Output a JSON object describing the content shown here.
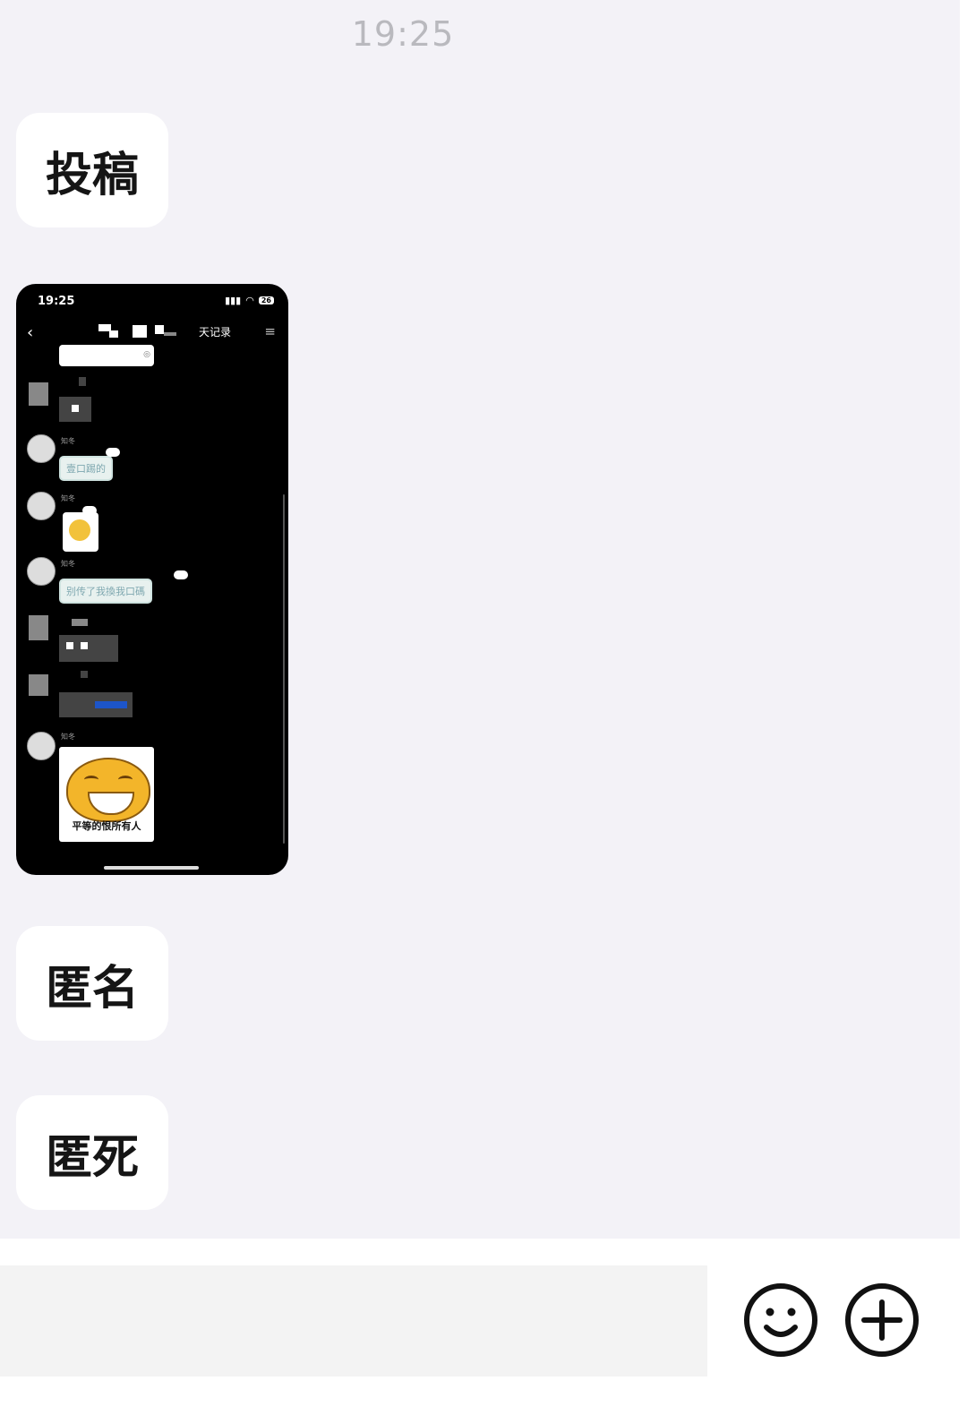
{
  "chat": {
    "timestamp": "19:25",
    "messages": [
      {
        "type": "text",
        "text": "投稿"
      },
      {
        "type": "image"
      },
      {
        "type": "text",
        "text": "匿名"
      },
      {
        "type": "text",
        "text": "匿死"
      }
    ]
  },
  "screenshot": {
    "status_time": "19:25",
    "battery": "26",
    "title": "天记录",
    "msg_1": "壹口踢的",
    "msg_2": "别传了我換我口碼",
    "label": "知冬",
    "sticker_caption": "平等的恨所有人"
  },
  "input_bar": {
    "emoji_icon": "smiley-icon",
    "plus_icon": "plus-circle-icon"
  }
}
